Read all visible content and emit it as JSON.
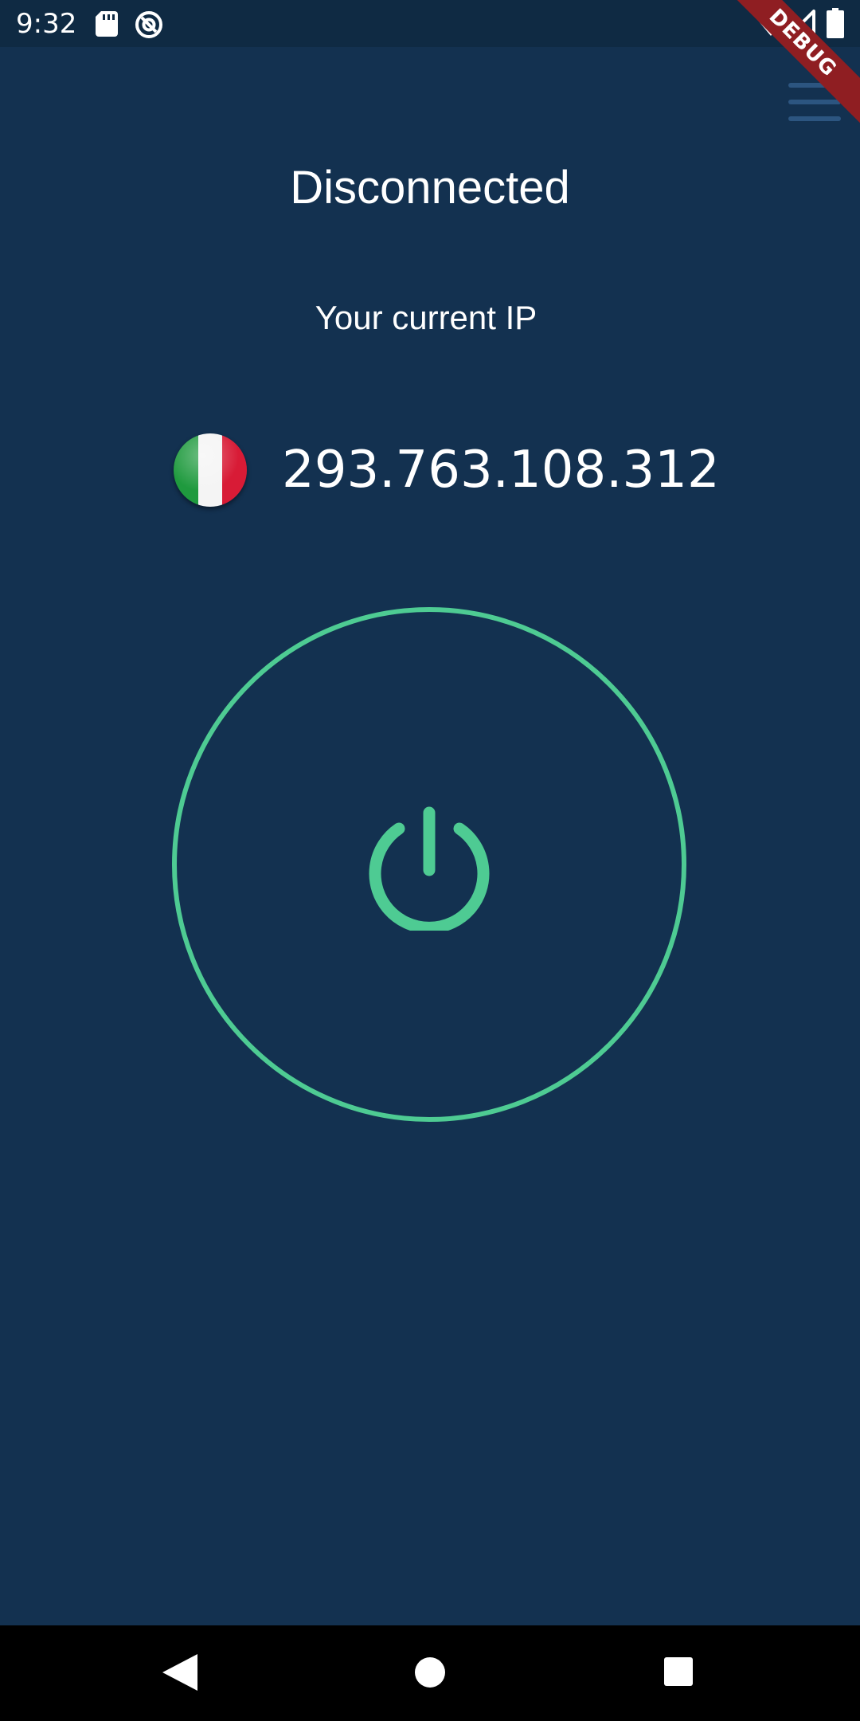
{
  "status_bar": {
    "time": "9:32",
    "icons": [
      "sd-card-icon",
      "vpn-status-icon",
      "wifi-icon",
      "signal-icon",
      "battery-icon"
    ]
  },
  "debug_banner": "DEBUG",
  "header": {
    "menu_icon": "hamburger-menu-icon"
  },
  "connection": {
    "status": "Disconnected",
    "ip_label": "Your current IP",
    "ip_address": "293.763.108.312",
    "country_flag": "italy-flag-icon"
  },
  "power_button": {
    "icon": "power-icon",
    "color": "#4ecb93"
  },
  "nav_bar": {
    "buttons": [
      "back-button",
      "home-button",
      "recents-button"
    ]
  },
  "colors": {
    "background": "#133150",
    "status_bar": "#0f2a43",
    "accent": "#4ecb93",
    "menu": "#2c5580",
    "debug_banner": "#8f1e22"
  }
}
